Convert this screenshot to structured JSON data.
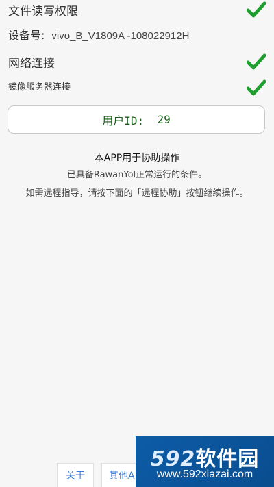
{
  "status": {
    "file_permission": {
      "label": "文件读写权限",
      "ok": true
    },
    "device": {
      "label": "设备号:",
      "value": "vivo_B_V1809A -108022912H"
    },
    "network": {
      "label": "网络连接",
      "ok": true
    },
    "mirror_server": {
      "label": "镜像服务器连接",
      "ok": true
    }
  },
  "user": {
    "label": "用户ID:",
    "id": "29"
  },
  "info": {
    "title": "本APP用于协助操作",
    "line1": "已具备RawanYol正常运行的条件。",
    "line2": "如需远程指导，请按下面的「远程协助」按钮继续操作。"
  },
  "buttons": {
    "about": "关于",
    "other_apps": "其他APP"
  },
  "watermark": {
    "brand_num": "592",
    "brand_text": "软件园",
    "url": "www.592xiazai.com"
  },
  "colors": {
    "check": "#1e9e2f",
    "userid_text": "#1a5c1a",
    "button_text": "#3a7bd5",
    "watermark_bg": "#0d5ca7"
  },
  "icons": {
    "status_ok": "check-icon"
  }
}
